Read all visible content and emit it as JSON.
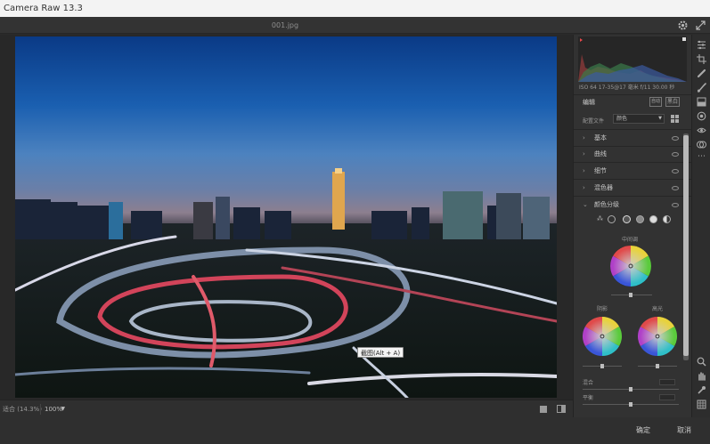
{
  "window": {
    "title": "Camera Raw 13.3"
  },
  "topbar": {
    "filename": "001.jpg",
    "settings_icon": "gear-icon",
    "fullscreen_icon": "expand-icon"
  },
  "photo": {
    "tooltip": "截图(Alt + A)"
  },
  "bottombar": {
    "info": "适合 (14.3%)",
    "zoom": "100%"
  },
  "footer": {
    "done": "确定",
    "cancel": "取消"
  },
  "panel": {
    "meta": "ISO 64   17-35@17 毫米   f/11   30.00 秒",
    "edit": {
      "title": "编辑",
      "btn_auto": "自动",
      "btn_bw": "黑白"
    },
    "profile": {
      "label": "配置文件",
      "value": "颜色"
    },
    "sections": [
      {
        "label": "基本",
        "expanded": false
      },
      {
        "label": "曲线",
        "expanded": false
      },
      {
        "label": "细节",
        "expanded": false
      },
      {
        "label": "混色器",
        "expanded": false
      },
      {
        "label": "颜色分级",
        "expanded": true
      }
    ],
    "color_grading": {
      "midtones": "中间调",
      "shadows": "阴影",
      "highlights": "高光",
      "blend": "混合",
      "balance": "平衡"
    }
  },
  "colors": {
    "accent_red": "#e8484b",
    "panel_bg": "#323232",
    "canvas_bg": "#282828"
  }
}
